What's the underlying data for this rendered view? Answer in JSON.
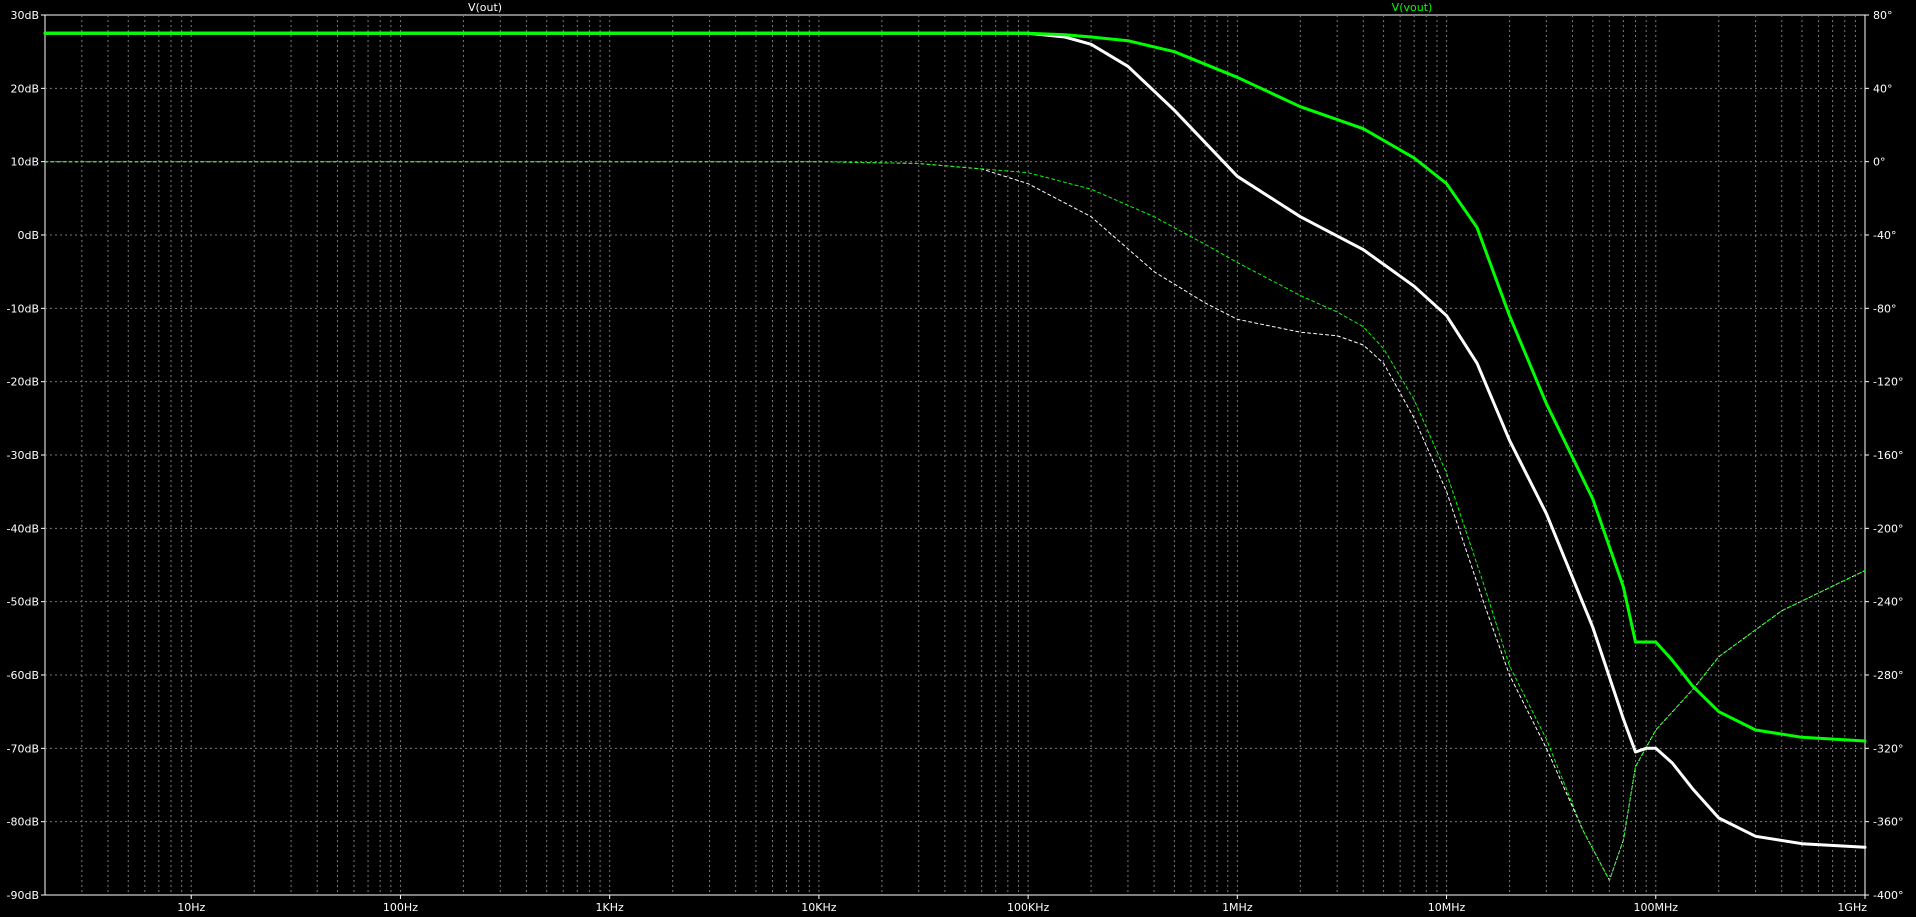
{
  "chart_data": {
    "type": "line",
    "x_scale": "log",
    "grid": true,
    "background": "#000000",
    "traces_legend": [
      {
        "name": "V(out)",
        "color": "#ffffff"
      },
      {
        "name": "V(vout)",
        "color": "#00ff00"
      }
    ],
    "x_axis": {
      "range": [
        2,
        1000000000
      ],
      "ticks": [
        {
          "value": 10,
          "label": "10Hz"
        },
        {
          "value": 100,
          "label": "100Hz"
        },
        {
          "value": 1000,
          "label": "1KHz"
        },
        {
          "value": 10000,
          "label": "10KHz"
        },
        {
          "value": 100000,
          "label": "100KHz"
        },
        {
          "value": 1000000,
          "label": "1MHz"
        },
        {
          "value": 10000000,
          "label": "10MHz"
        },
        {
          "value": 100000000,
          "label": "100MHz"
        },
        {
          "value": 1000000000,
          "label": "1GHz"
        }
      ]
    },
    "y_left": {
      "unit": "dB",
      "range": [
        -90,
        30
      ],
      "ticks": [
        {
          "value": 30,
          "label": "30dB"
        },
        {
          "value": 20,
          "label": "20dB"
        },
        {
          "value": 10,
          "label": "10dB"
        },
        {
          "value": 0,
          "label": "0dB"
        },
        {
          "value": -10,
          "label": "-10dB"
        },
        {
          "value": -20,
          "label": "-20dB"
        },
        {
          "value": -30,
          "label": "-30dB"
        },
        {
          "value": -40,
          "label": "-40dB"
        },
        {
          "value": -50,
          "label": "-50dB"
        },
        {
          "value": -60,
          "label": "-60dB"
        },
        {
          "value": -70,
          "label": "-70dB"
        },
        {
          "value": -80,
          "label": "-80dB"
        },
        {
          "value": -90,
          "label": "-90dB"
        }
      ]
    },
    "y_right": {
      "unit": "°",
      "range": [
        -400,
        80
      ],
      "ticks": [
        {
          "value": 80,
          "label": "80°"
        },
        {
          "value": 40,
          "label": "40°"
        },
        {
          "value": 0,
          "label": "0°"
        },
        {
          "value": -40,
          "label": "-40°"
        },
        {
          "value": -80,
          "label": "-80°"
        },
        {
          "value": -120,
          "label": "-120°"
        },
        {
          "value": -160,
          "label": "-160°"
        },
        {
          "value": -200,
          "label": "-200°"
        },
        {
          "value": -240,
          "label": "-240°"
        },
        {
          "value": -280,
          "label": "-280°"
        },
        {
          "value": -320,
          "label": "-320°"
        },
        {
          "value": -360,
          "label": "-360°"
        },
        {
          "value": -400,
          "label": "-400°"
        }
      ]
    },
    "series": [
      {
        "name": "V(out)",
        "quantity": "magnitude",
        "axis": "left",
        "color": "#ffffff",
        "style": "solid",
        "x": [
          2,
          10,
          100,
          1000,
          10000,
          60000,
          100000,
          150000,
          200000,
          300000,
          500000,
          1000000,
          2000000,
          4000000,
          7000000,
          10000000,
          14000000,
          20000000,
          30000000,
          50000000,
          70000000,
          80000000,
          90000000,
          100000000,
          120000000,
          150000000,
          200000000,
          300000000,
          500000000,
          1000000000
        ],
        "y": [
          27.5,
          27.5,
          27.5,
          27.5,
          27.5,
          27.5,
          27.5,
          27.0,
          26.0,
          23.0,
          17.0,
          8.0,
          2.5,
          -2.0,
          -7.0,
          -11.0,
          -17.5,
          -28.0,
          -38.0,
          -53.5,
          -66.0,
          -70.5,
          -70.0,
          -70.0,
          -72.0,
          -75.5,
          -79.5,
          -82.0,
          -83.0,
          -83.5
        ]
      },
      {
        "name": "V(vout)",
        "quantity": "magnitude",
        "axis": "left",
        "color": "#00ff00",
        "style": "solid",
        "x": [
          2,
          10,
          100,
          1000,
          10000,
          100000,
          150000,
          200000,
          300000,
          500000,
          1000000,
          2000000,
          4000000,
          7000000,
          10000000,
          14000000,
          20000000,
          30000000,
          50000000,
          70000000,
          80000000,
          90000000,
          100000000,
          120000000,
          150000000,
          200000000,
          300000000,
          500000000,
          1000000000
        ],
        "y": [
          27.5,
          27.5,
          27.5,
          27.5,
          27.5,
          27.5,
          27.3,
          27.0,
          26.5,
          25.0,
          21.5,
          17.5,
          14.5,
          10.5,
          7.0,
          1.0,
          -11.0,
          -23.0,
          -36.0,
          -48.0,
          -55.5,
          -55.5,
          -55.5,
          -58.0,
          -61.5,
          -65.0,
          -67.5,
          -68.5,
          -69.0
        ]
      },
      {
        "name": "V(out)",
        "quantity": "phase",
        "axis": "right",
        "color": "#ffffff",
        "style": "dashed",
        "x": [
          2,
          10,
          100,
          1000,
          10000,
          30000,
          60000,
          100000,
          200000,
          400000,
          700000,
          1000000,
          2000000,
          3000000,
          4000000,
          5000000,
          7000000,
          10000000,
          15000000,
          20000000,
          30000000,
          45000000,
          60000000,
          70000000,
          80000000,
          100000000,
          150000000,
          200000000,
          400000000,
          1000000000
        ],
        "y": [
          0,
          0,
          0,
          0,
          0,
          -1,
          -4,
          -12,
          -30,
          -60,
          -77,
          -86,
          -93,
          -95,
          -100,
          -110,
          -140,
          -180,
          -240,
          -280,
          -320,
          -365,
          -392,
          -370,
          -330,
          -310,
          -288,
          -270,
          -245,
          -223
        ]
      },
      {
        "name": "V(vout)",
        "quantity": "phase",
        "axis": "right",
        "color": "#00ff00",
        "style": "dashed",
        "x": [
          2,
          10,
          100,
          1000,
          10000,
          30000,
          100000,
          200000,
          400000,
          700000,
          1000000,
          2000000,
          3000000,
          4000000,
          5000000,
          7000000,
          10000000,
          15000000,
          20000000,
          30000000,
          45000000,
          60000000,
          70000000,
          80000000,
          100000000,
          150000000,
          200000000,
          400000000,
          1000000000
        ],
        "y": [
          0,
          0,
          0,
          0,
          0,
          -1,
          -6,
          -15,
          -30,
          -45,
          -55,
          -73,
          -82,
          -90,
          -102,
          -130,
          -170,
          -230,
          -275,
          -315,
          -365,
          -392,
          -370,
          -330,
          -310,
          -288,
          -270,
          -245,
          -223
        ]
      }
    ]
  }
}
